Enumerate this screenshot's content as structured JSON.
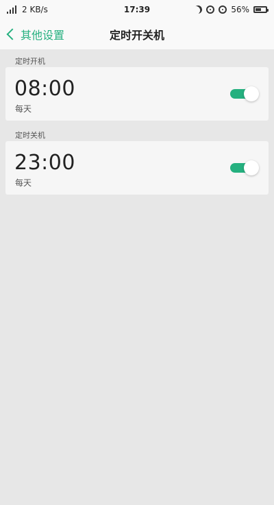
{
  "status_bar": {
    "network_speed": "2 KB/s",
    "time": "17:39",
    "battery_percent": "56%",
    "battery_level": 0.56,
    "icons": [
      "signal-icon",
      "moon-icon",
      "location-icon",
      "alarm-icon",
      "battery-icon"
    ]
  },
  "nav": {
    "back_label": "其他设置",
    "title": "定时开关机"
  },
  "sections": [
    {
      "label": "定时开机",
      "time": "08:00",
      "repeat": "每天",
      "enabled": true
    },
    {
      "label": "定时关机",
      "time": "23:00",
      "repeat": "每天",
      "enabled": true
    }
  ],
  "colors": {
    "accent": "#25b07f",
    "background": "#e7e7e7",
    "card": "#f6f6f6"
  }
}
